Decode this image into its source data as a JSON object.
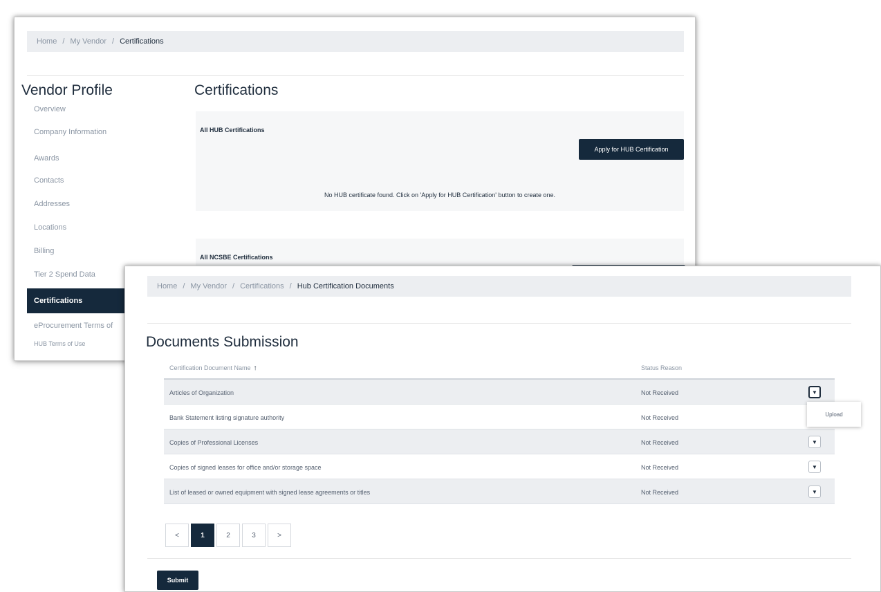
{
  "back_window": {
    "breadcrumb": [
      "Home",
      "My Vendor",
      "Certifications"
    ],
    "sidebar_title": "Vendor Profile",
    "sidebar_items": [
      "Overview",
      "Company Information",
      "Awards",
      "Contacts",
      "Addresses",
      "Locations",
      "Billing",
      "Tier 2 Spend Data",
      "Certifications",
      "eProcurement Terms of",
      "HUB Terms of Use"
    ],
    "active_item": "Certifications",
    "page_title": "Certifications",
    "hub_panel": {
      "label": "All HUB Certifications",
      "button": "Apply for HUB Certification",
      "empty_message": "No HUB certificate found. Click on 'Apply for HUB Certification' button to create one."
    },
    "ncsbe_panel": {
      "label": "All NCSBE Certifications"
    }
  },
  "front_window": {
    "breadcrumb": [
      "Home",
      "My Vendor",
      "Certifications",
      "Hub Certification Documents"
    ],
    "page_title": "Documents Submission",
    "columns": {
      "name": "Certification Document Name",
      "status": "Status Reason"
    },
    "rows": [
      {
        "name": "Articles of Organization",
        "status": "Not Received"
      },
      {
        "name": "Bank Statement listing signature authority",
        "status": "Not Received"
      },
      {
        "name": "Copies of Professional Licenses",
        "status": "Not Received"
      },
      {
        "name": "Copies of signed leases for office and/or storage space",
        "status": "Not Received"
      },
      {
        "name": "List of leased or owned equipment with signed lease agreements or titles",
        "status": "Not Received"
      }
    ],
    "dropdown_option": "Upload",
    "pagination": {
      "prev": "<",
      "pages": [
        "1",
        "2",
        "3"
      ],
      "current": "1",
      "next": ">"
    },
    "submit_label": "Submit"
  },
  "icons": {
    "sort": "sort-up-arrow-icon",
    "row_action": "chevron-down-icon"
  },
  "colors": {
    "primary_dark": "#15293c",
    "breadcrumb_bg": "#eceef1",
    "muted_text": "#8a95a3"
  }
}
